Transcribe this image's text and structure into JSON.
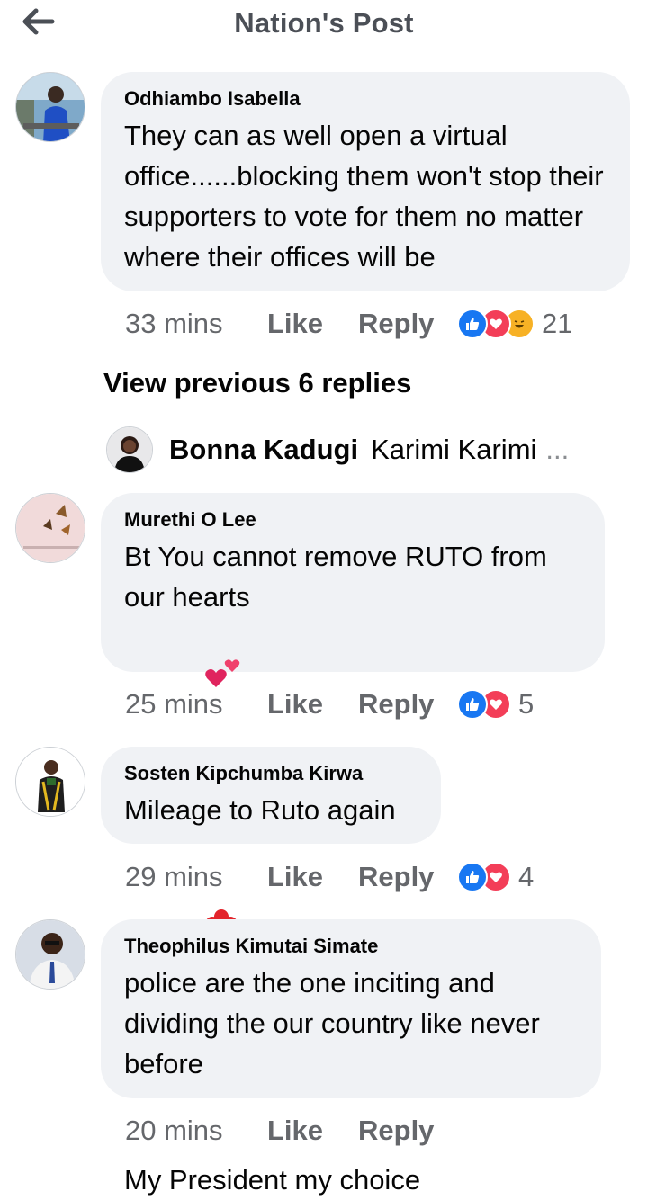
{
  "header": {
    "title": "Nation's Post",
    "back_icon": "arrow-left-icon"
  },
  "comments": [
    {
      "author": "Odhiambo Isabella",
      "text": "They can as well open a virtual office......blocking them won't stop their supporters to vote for them no matter where their offices will be",
      "time": "33 mins",
      "like": "Like",
      "reply": "Reply",
      "reactions": [
        "like",
        "love",
        "haha"
      ],
      "reaction_count": "21"
    },
    {
      "author": "Murethi O Lee",
      "text_line1": "Bt You cannot remove RUTO from",
      "text_line2": "our hearts",
      "text_line3": "My President my choice",
      "emojis": [
        "two-hearts-icon",
        "heart-eyes-icon",
        "hibiscus-icon",
        "hibiscus-icon"
      ],
      "time": "25 mins",
      "like": "Like",
      "reply": "Reply",
      "reactions": [
        "like",
        "love"
      ],
      "reaction_count": "5"
    },
    {
      "author": "Sosten Kipchumba Kirwa",
      "text": "Mileage to Ruto again",
      "time": "29 mins",
      "like": "Like",
      "reply": "Reply",
      "reactions": [
        "like",
        "love"
      ],
      "reaction_count": "4"
    },
    {
      "author": "Theophilus Kimutai Simate",
      "text": "police are the one inciting and dividing the our country like never before",
      "time": "20 mins",
      "like": "Like",
      "reply": "Reply"
    }
  ],
  "view_previous": "View previous 6 replies",
  "reply_preview": {
    "name": "Bonna Kadugi",
    "text": "Karimi Karimi",
    "ellipsis": "..."
  },
  "colors": {
    "bubble": "#f0f2f5",
    "meta": "#65676b",
    "like_blue": "#1877f2",
    "love_red": "#f33e58",
    "haha_yellow": "#f7b125"
  }
}
